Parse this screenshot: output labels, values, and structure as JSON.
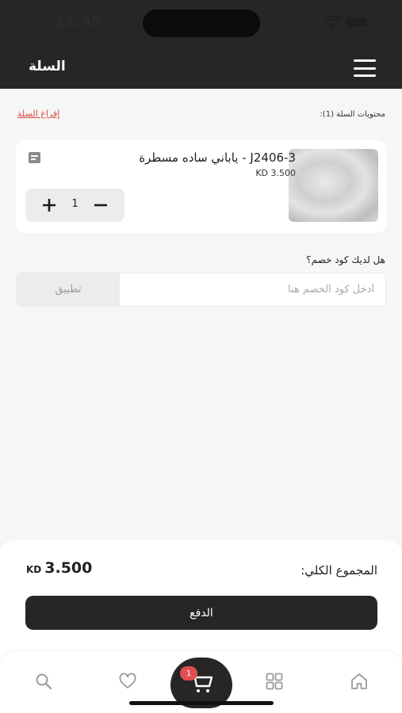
{
  "status_bar": {
    "time": "11:45"
  },
  "header": {
    "title": "السلة",
    "menu_icon": "hamburger-icon"
  },
  "cart": {
    "contents_label": "محتويات السلة (1):",
    "empty_cart_label": "إفراغ السلة",
    "items": [
      {
        "name": "ياباني ساده مسطرة - J2406-3",
        "price": "KD  3.500",
        "quantity": "1"
      }
    ]
  },
  "discount": {
    "question": "هل لديك كود خصم؟",
    "placeholder": "أدخل كود الخصم هنا",
    "apply_label": "تطبيق"
  },
  "summary": {
    "total_label": "المجموع الكلي:",
    "currency": "KD",
    "total_value": "3.500",
    "pay_label": "الدفع"
  },
  "bottom_nav": {
    "items": [
      "home-icon",
      "grid-icon",
      "cart-icon",
      "heart-icon",
      "search-icon"
    ],
    "cart_badge": "1",
    "accent": "#272525",
    "badge_color": "#e05050"
  }
}
